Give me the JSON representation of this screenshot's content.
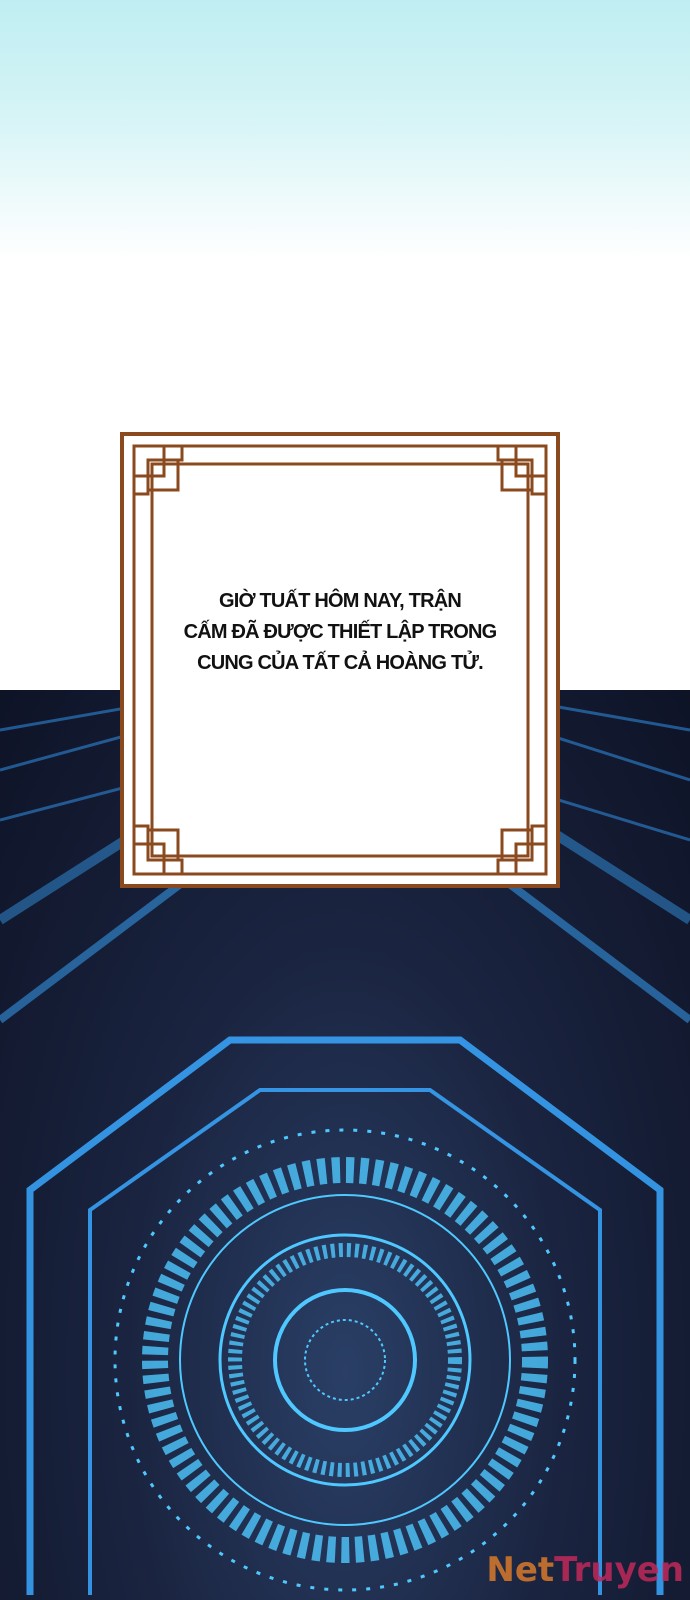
{
  "caption": {
    "lines": [
      "GIỜ TUẤT HÔM NAY,  TRẬN",
      "CẤM ĐÃ ĐƯỢC THIẾT LẬP TRONG",
      "CUNG CỦA TẤT CẢ HOÀNG TỬ."
    ]
  },
  "watermark": {
    "part1": "Net",
    "part2": "Truyen"
  },
  "colors": {
    "frame": "#8a4a1e",
    "glow": "#3aa8ff",
    "sky": "#bfeef2"
  }
}
